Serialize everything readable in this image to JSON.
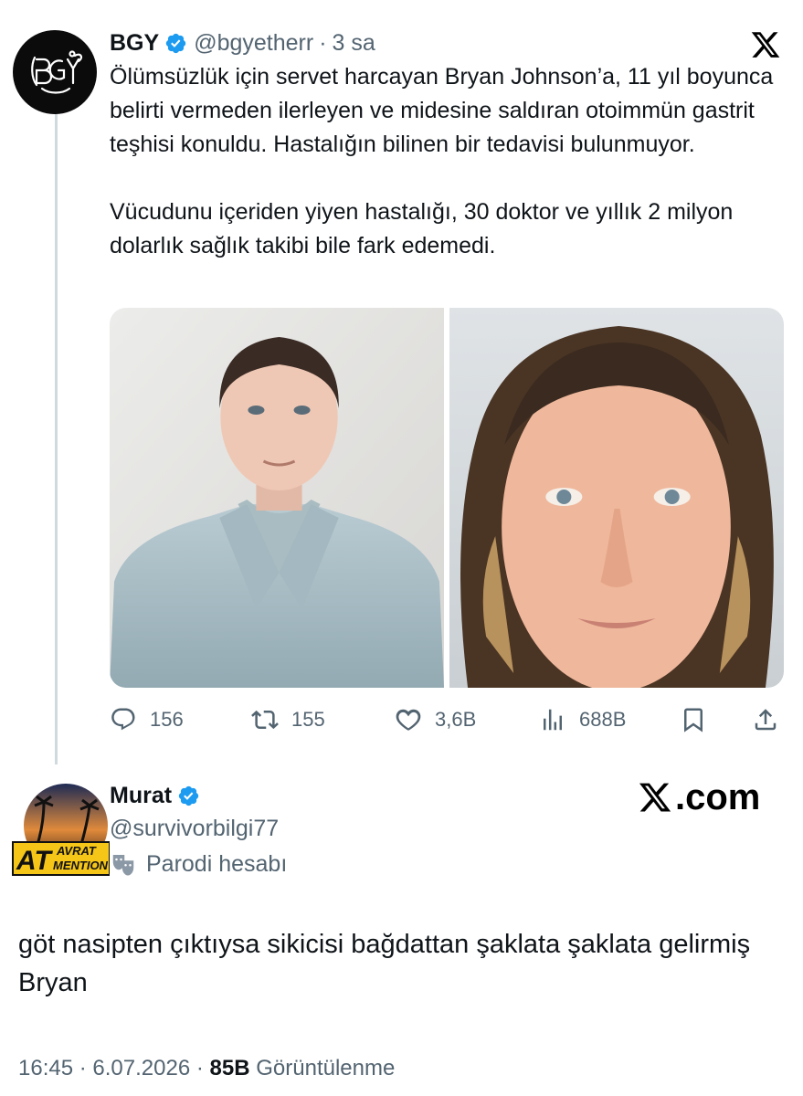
{
  "original_tweet": {
    "author_name": "BGY",
    "handle": "@bgyetherr",
    "time_ago": "3 sa",
    "avatar_text": "BGY",
    "paragraphs": [
      "Ölümsüzlük için servet harcayan Bryan Johnson’a, 11 yıl boyunca belirti vermeden ilerleyen ve midesine saldıran otoimmün gastrit teşhisi konuldu. Hastalığın bilinen bir tedavisi bulunmuyor.",
      "Vücudunu içeriden yiyen hastalığı, 30 doktor ve yıllık 2 milyon dolarlık sağlık takibi bile fark edemedi."
    ],
    "actions": {
      "replies": "156",
      "reposts": "155",
      "likes": "3,6B",
      "views": "688B"
    }
  },
  "reply_tweet": {
    "author_name": "Murat",
    "handle": "@survivorbilgi77",
    "parody_label": "Parodi hesabı",
    "avatar_text_top": "AVRAT",
    "avatar_text_main": "AT",
    "avatar_text_sub": "MENTION",
    "text": "göt nasipten çıktıysa sikicisi bağdattan şaklata şaklata gelirmiş Bryan",
    "time": "16:45",
    "date": "6.07.2026",
    "views_count": "85B",
    "views_label": "Görüntülenme"
  },
  "watermark": ".com",
  "colors": {
    "verified_blue": "#1d9bf0",
    "muted": "#536471",
    "text": "#0f1419"
  }
}
